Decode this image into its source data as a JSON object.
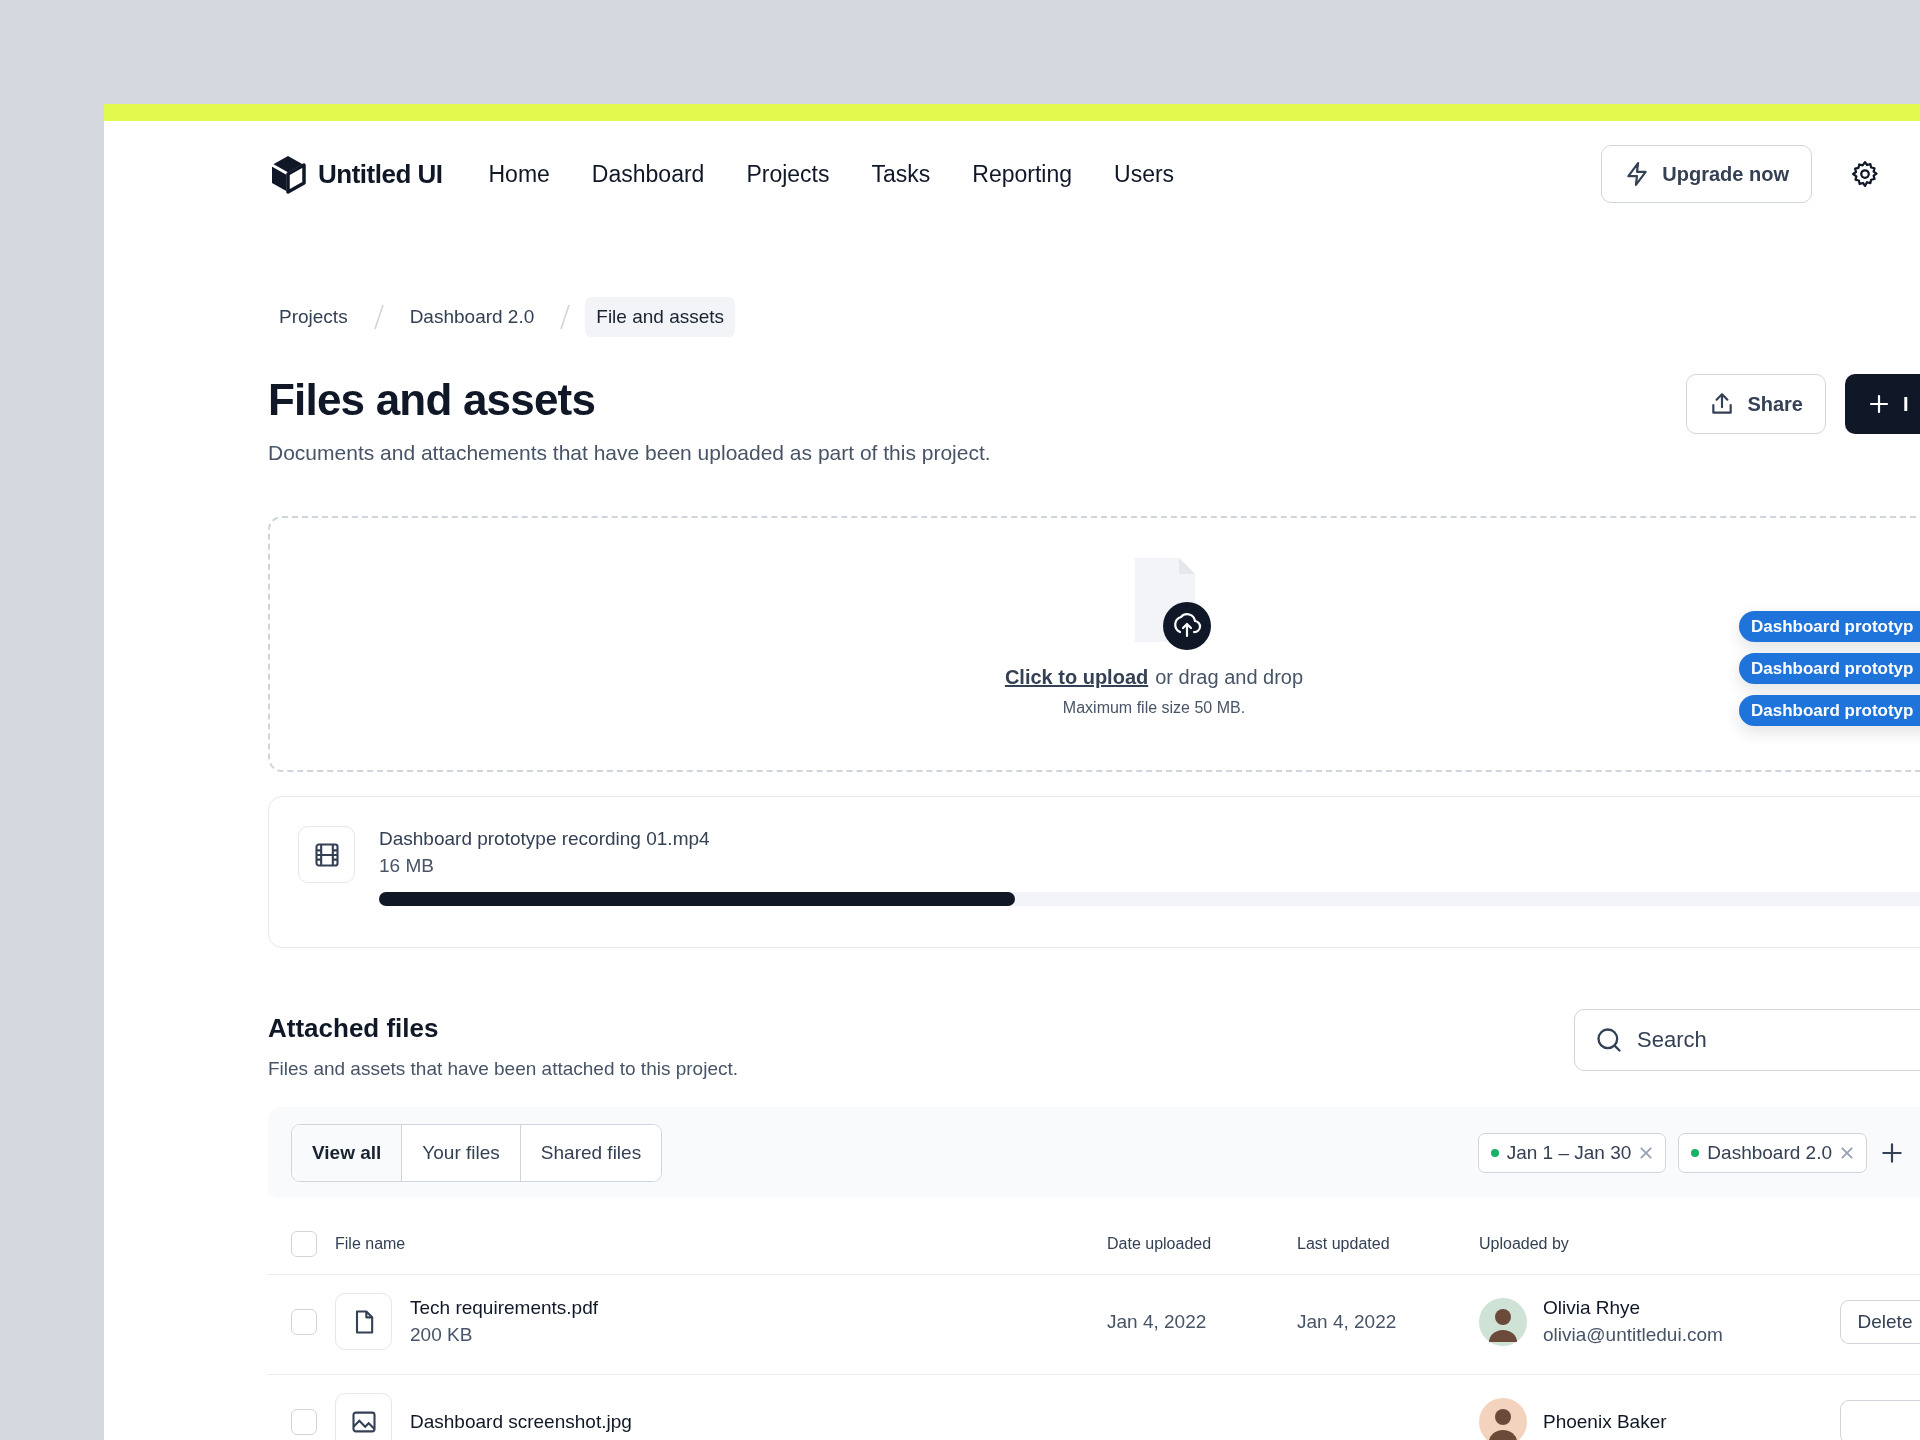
{
  "brand": {
    "name": "Untitled UI"
  },
  "nav": [
    {
      "label": "Home"
    },
    {
      "label": "Dashboard"
    },
    {
      "label": "Projects"
    },
    {
      "label": "Tasks"
    },
    {
      "label": "Reporting"
    },
    {
      "label": "Users"
    }
  ],
  "upgrade_button": {
    "label": "Upgrade now"
  },
  "breadcrumbs": [
    {
      "label": "Projects",
      "selected": false
    },
    {
      "label": "Dashboard 2.0",
      "selected": false
    },
    {
      "label": "File and assets",
      "selected": true
    }
  ],
  "page": {
    "title": "Files and assets",
    "subtitle": "Documents and attachements that have been uploaded as part of this project.",
    "actions": [
      {
        "kind": "secondary",
        "label": "Share"
      },
      {
        "kind": "primary",
        "label": "I"
      }
    ]
  },
  "upload": {
    "link": "Click to upload",
    "text": "or drag and drop",
    "hint": "Maximum file size 50 MB.",
    "dragged_files": [
      "Dashboard prototyp",
      "Dashboard prototyp",
      "Dashboard prototyp"
    ]
  },
  "upload_progress": {
    "name": "Dashboard prototype recording 01.mp4",
    "size": "16 MB",
    "level": 0.39
  },
  "attached": {
    "title": "Attached files",
    "subtitle": "Files and assets that have been attached to this project.",
    "search": {
      "placeholder": "Search"
    },
    "tabs": [
      {
        "label": "View all",
        "selected": true
      },
      {
        "label": "Your files",
        "selected": false
      },
      {
        "label": "Shared files",
        "selected": false
      }
    ],
    "filters": [
      {
        "label": "Jan 1 – Jan 30"
      },
      {
        "label": "Dashboard 2.0"
      }
    ],
    "header_checked": false,
    "columns": [
      "File name",
      "Date uploaded",
      "Last updated",
      "Uploaded by"
    ],
    "rows": [
      {
        "kind": "document",
        "checked": false,
        "name": "Tech requirements.pdf",
        "size": "200 KB",
        "date_uploaded": "Jan 4, 2022",
        "last_updated": "Jan 4, 2022",
        "uploader": {
          "name": "Olivia Rhye",
          "email": "olivia@untitledui.com",
          "color": "#cfe2d6"
        },
        "action": "Delete"
      },
      {
        "kind": "image",
        "checked": false,
        "name": "Dashboard screenshot.jpg",
        "uploader": {
          "name": "Phoenix Baker",
          "color": "#f3d3bd"
        }
      }
    ]
  }
}
